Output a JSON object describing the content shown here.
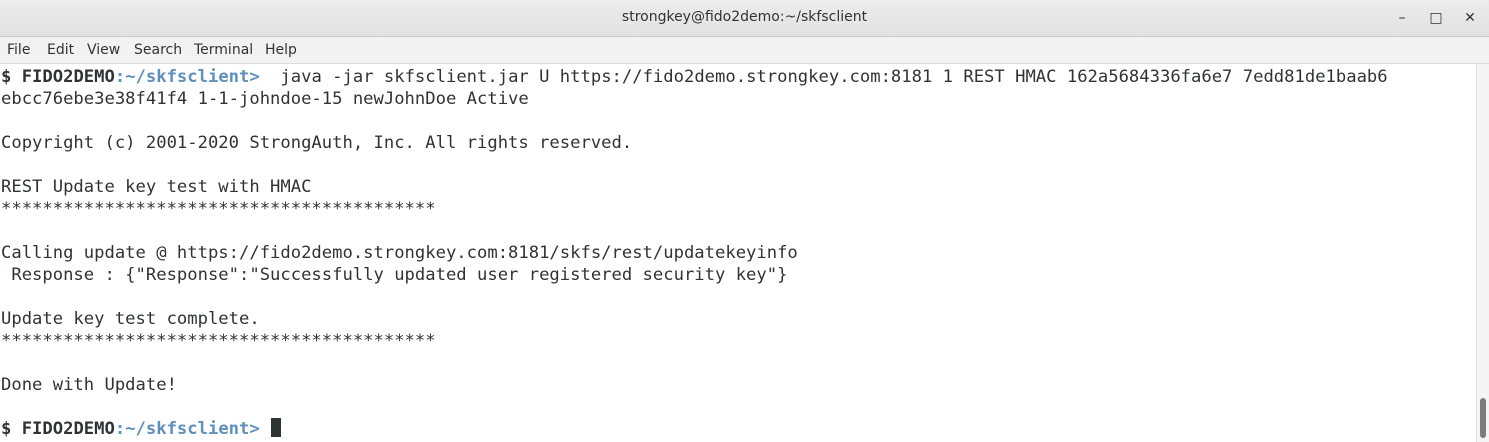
{
  "window": {
    "title": "strongkey@fido2demo:~/skfsclient",
    "minimize_glyph": "–",
    "maximize_glyph": "□",
    "close_glyph": "✕"
  },
  "menubar": {
    "file": "File",
    "edit": "Edit",
    "view": "View",
    "search": "Search",
    "terminal": "Terminal",
    "help": "Help"
  },
  "terminal": {
    "prompt1": {
      "dollar": "$ ",
      "host": "FIDO2DEMO",
      "path": ":~/skfsclient>",
      "command": "  java -jar skfsclient.jar U https://fido2demo.strongkey.com:8181 1 REST HMAC 162a5684336fa6e7 7edd81de1baab6"
    },
    "line2": "ebcc76ebe3e38f41f4 1-1-johndoe-15 newJohnDoe Active",
    "line4": "Copyright (c) 2001-2020 StrongAuth, Inc. All rights reserved.",
    "line6": "REST Update key test with HMAC",
    "line7": "******************************************",
    "line9": "Calling update @ https://fido2demo.strongkey.com:8181/skfs/rest/updatekeyinfo",
    "line10": " Response : {\"Response\":\"Successfully updated user registered security key\"}",
    "line12": "Update key test complete.",
    "line13": "******************************************",
    "line15": "Done with Update!",
    "prompt2": {
      "dollar": "$ ",
      "host": "FIDO2DEMO",
      "path": ":~/skfsclient>",
      "command": " "
    }
  },
  "colors": {
    "prompt_path": "#5f8fc0",
    "text": "#2e3436",
    "background": "#ffffff"
  }
}
